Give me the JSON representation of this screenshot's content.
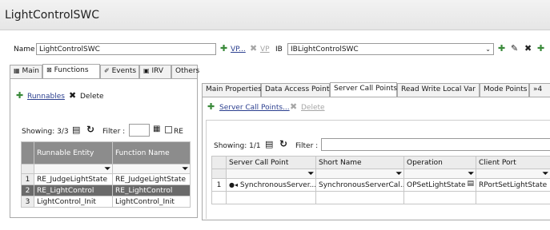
{
  "title": "LightControlSWC",
  "header": {
    "name_label": "Name",
    "name_value": "LightControlSWC",
    "vp_label": "VP...",
    "vp_disabled_label": "VP",
    "ib_label": "IB",
    "ib_value": "IBLightControlSWC"
  },
  "left_tabs": [
    "Main",
    "Functions",
    "Events",
    "IRV",
    "Others"
  ],
  "left_panel": {
    "runnables_link": "Runnables",
    "delete_label": "Delete",
    "showing": "Showing: 3/3",
    "filter_label": "Filter :",
    "re_label": "RE",
    "columns": [
      "Runnable Entity",
      "Function Name"
    ],
    "rows": [
      {
        "num": "1",
        "entity": "RE_JudgeLightState",
        "func": "RE_JudgeLightState"
      },
      {
        "num": "2",
        "entity": "RE_LightControl",
        "func": "RE_LightControl"
      },
      {
        "num": "3",
        "entity": "LightControl_Init",
        "func": "LightControl_Init"
      }
    ]
  },
  "right_tabs": [
    "Main Properties",
    "Data Access Points",
    "Server Call Points",
    "Read Write Local Var",
    "Mode Points",
    "»4"
  ],
  "right_panel": {
    "add_link": "Server Call Points...",
    "delete_label": "Delete",
    "showing": "Showing: 1/1",
    "filter_label": "Filter :",
    "columns": [
      "Server Call Point",
      "Short Name",
      "Operation",
      "Client Port"
    ],
    "rows": [
      {
        "num": "1",
        "scp": "SynchronousServer...",
        "short": "SynchronousServerCal...",
        "op": "OPSetLightState",
        "port": "RPortSetLightState"
      }
    ]
  },
  "colors": {
    "selected_row": "#6a6a6a",
    "header_dark": "#8c8c8c",
    "link": "#2b3f8f"
  }
}
